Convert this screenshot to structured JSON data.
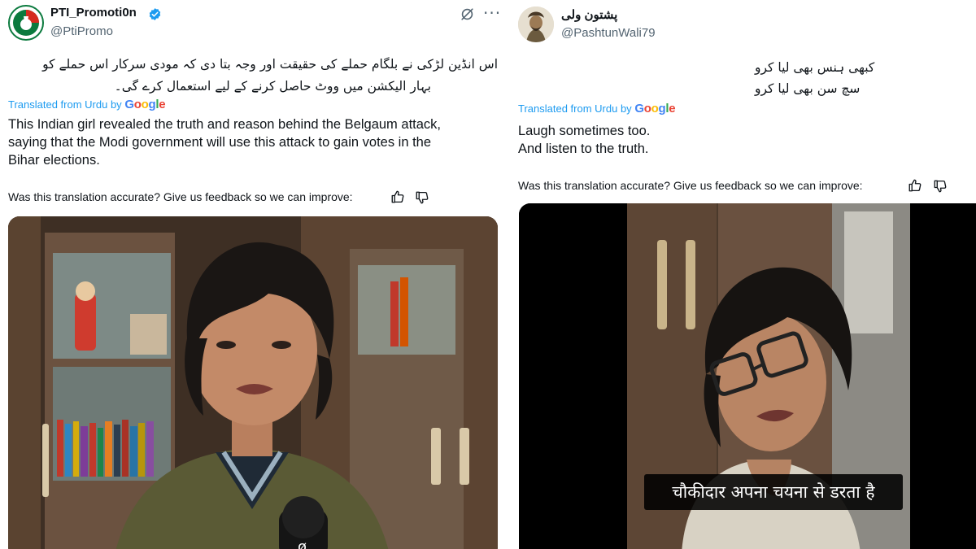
{
  "left_tweet": {
    "display_name": "PTI_Promoti0n",
    "handle": "@PtiPromo",
    "urdu_text_line1": "اس انڈین لڑکی نے بلگام حملے کی حقیقت اور وجہ بتا دی کہ مودی سرکار اس حملے کو",
    "urdu_text_line2": "بہار الیکشن میں ووٹ حاصل کرنے کے لیے استعمال کرے گی۔",
    "translated_label": "Translated from Urdu by",
    "translation_line1": "This Indian girl revealed the truth and reason behind the Belgaum attack,",
    "translation_line2": "saying that the Modi government will use this attack to gain votes in the",
    "translation_line3": "Bihar elections.",
    "feedback_text": "Was this translation accurate? Give us feedback so we can improve:",
    "icons": [
      "verified-icon",
      "grok-icon",
      "more-icon",
      "thumbs-up-icon",
      "thumbs-down-icon"
    ]
  },
  "right_tweet": {
    "display_name": "پشتون ولی",
    "handle": "@PashtunWali79",
    "urdu_text_line1": "کبھی ہنس بھی لیا کرو",
    "urdu_text_line2": "سچ سن بھی لیا کرو",
    "translated_label": "Translated from Urdu by",
    "translation_line1": "Laugh sometimes too.",
    "translation_line2": "And listen to the truth.",
    "feedback_text": "Was this translation accurate? Give us feedback so we can improve:",
    "video_subtitle": "चौकीदार अपना चयना से डरता है",
    "icons": [
      "thumbs-up-icon",
      "thumbs-down-icon"
    ]
  },
  "google_logo": {
    "letters": [
      "G",
      "o",
      "o",
      "g",
      "l",
      "e"
    ],
    "colors": [
      "#4285f4",
      "#ea4335",
      "#fbbc05",
      "#4285f4",
      "#34a853",
      "#ea4335"
    ]
  },
  "colors": {
    "link_blue": "#1d9bf0",
    "secondary_text": "#536471",
    "verified_blue": "#1d9bf0",
    "pti_green": "#0b7a3e",
    "pti_red": "#d52b1e"
  }
}
